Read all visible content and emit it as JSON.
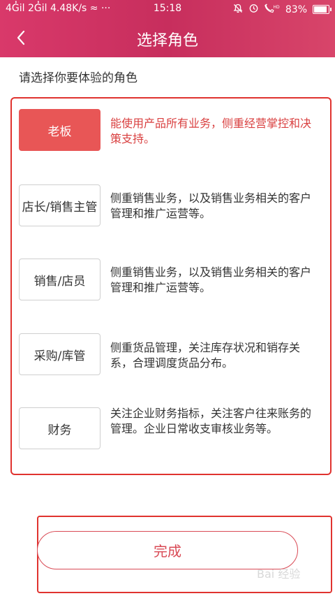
{
  "status_bar": {
    "left": "4G̓il 2G̓il 4.48K/s ≈ ···",
    "time": "15:18",
    "battery": "83%",
    "battery_level": 0.83
  },
  "nav": {
    "title": "选择角色"
  },
  "prompt": "请选择你要体验的角色",
  "roles": [
    {
      "label": "老板",
      "desc": "能使用产品所有业务，侧重经营掌控和决策支持。",
      "selected": true
    },
    {
      "label": "店长/销售主管",
      "desc": "侧重销售业务，以及销售业务相关的客户管理和推广运营等。",
      "selected": false
    },
    {
      "label": "销售/店员",
      "desc": "侧重销售业务，以及销售业务相关的客户管理和推广运营等。",
      "selected": false
    },
    {
      "label": "采购/库管",
      "desc": "侧重货品管理，关注库存状况和销存关系，合理调度货品分布。",
      "selected": false
    },
    {
      "label": "财务",
      "desc": "关注企业财务指标，关注客户往来账务的管理。企业日常收支审核业务等。",
      "selected": false
    }
  ],
  "done_button": "完成",
  "watermark": "Bai 经验",
  "colors": {
    "accent": "#d9396a",
    "selected": "#e85656",
    "annotation": "#e0332f"
  }
}
